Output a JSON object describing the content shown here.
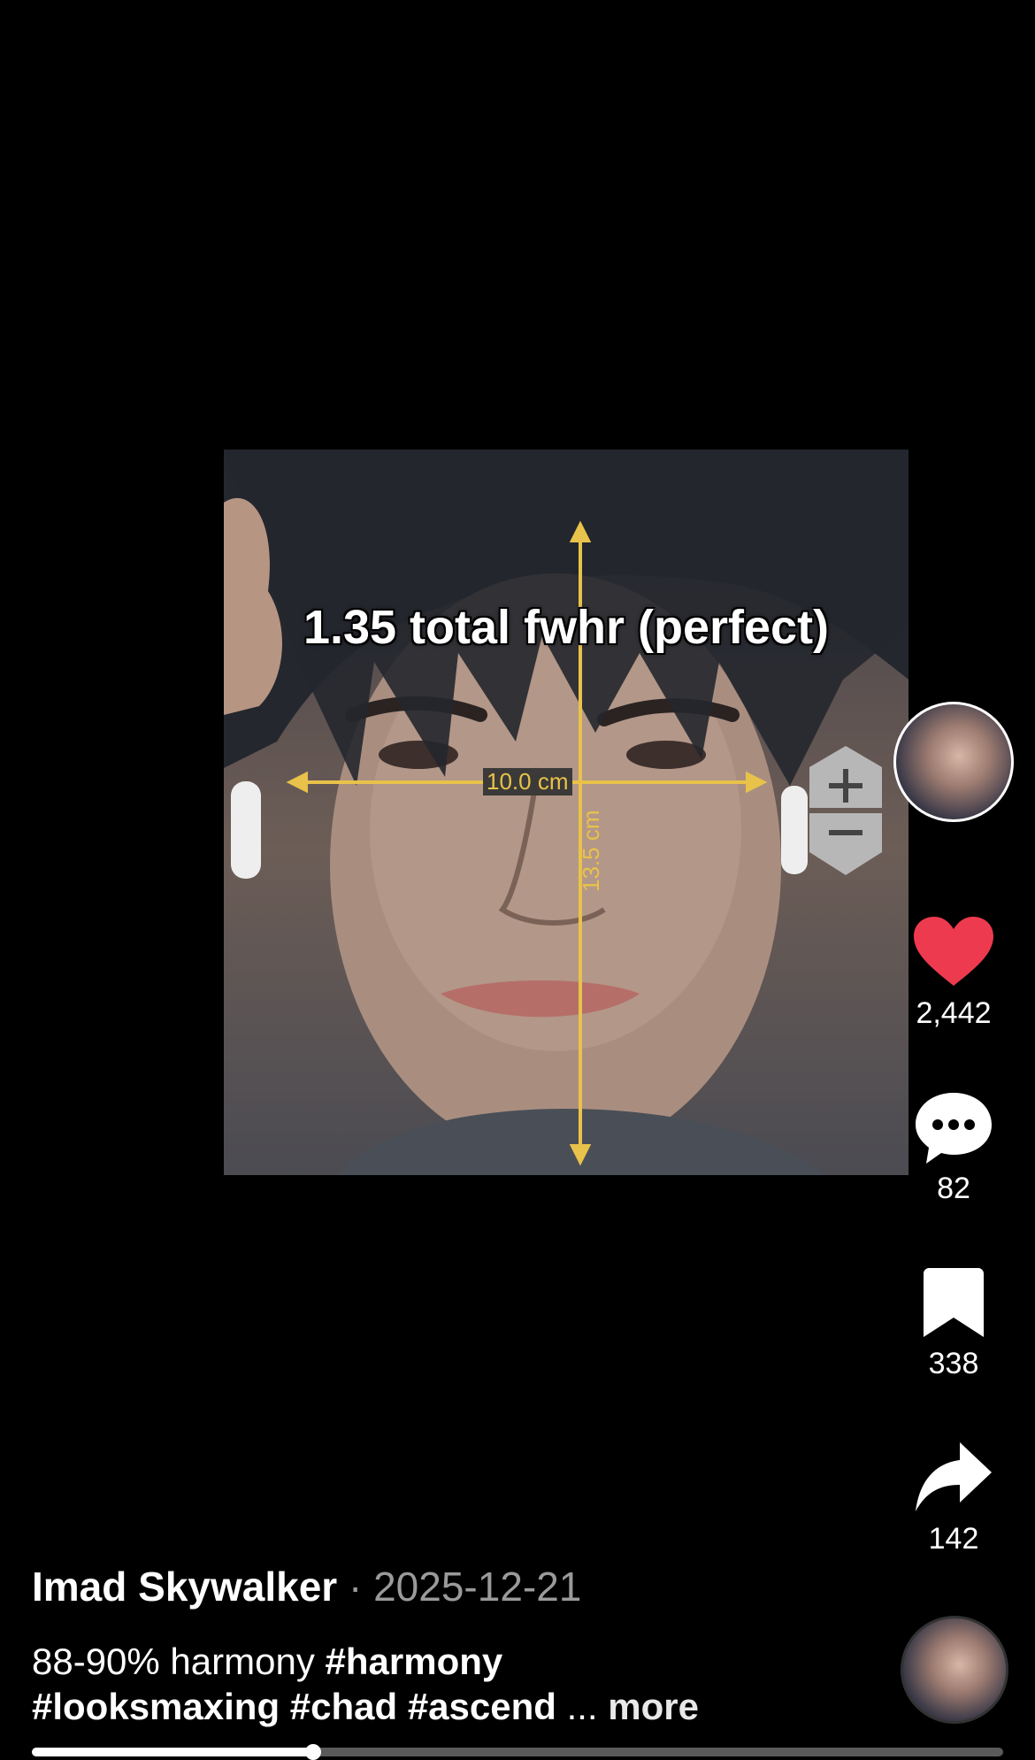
{
  "video": {
    "overlay_title": "1.35 total fwhr (perfect)",
    "width_measure": "10.0 cm",
    "height_measure": "13.5 cm",
    "progress": 0.29
  },
  "actions": {
    "likes": "2,442",
    "comments": "82",
    "saves": "338",
    "shares": "142"
  },
  "author": {
    "name": "Imad Skywalker",
    "separator": "·",
    "date": "2025-12-21"
  },
  "caption": {
    "text": "88-90% harmony  ",
    "tags_line1": "#harmony",
    "tags_line2": "#looksmaxing #chad #ascend",
    "ellipsis": " ... ",
    "more": "more"
  },
  "colors": {
    "like": "#ee3a4f",
    "measure": "#e8c24a",
    "date": "#9a9a9a"
  },
  "icons": [
    "heart-icon",
    "comment-icon",
    "bookmark-icon",
    "share-icon",
    "zoom-in-icon",
    "zoom-out-icon"
  ]
}
